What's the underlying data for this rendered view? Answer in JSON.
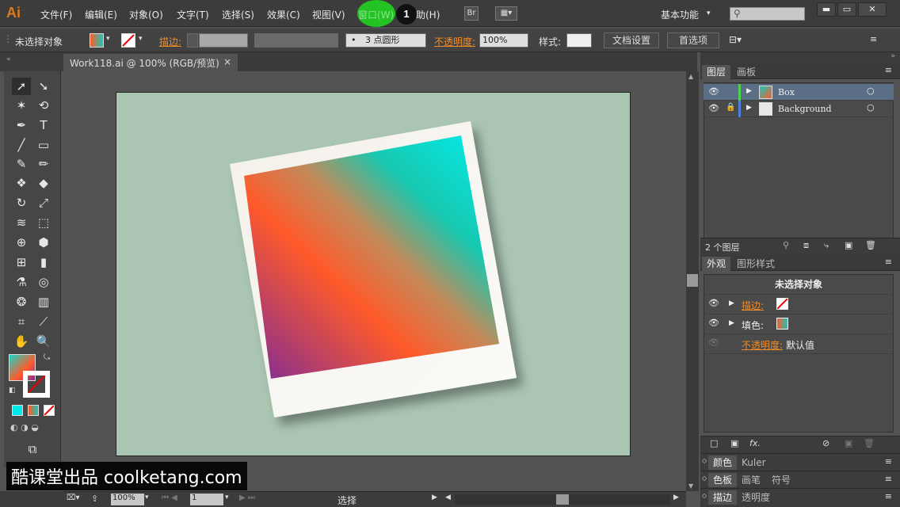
{
  "app": {
    "logo": "Ai"
  },
  "menus": [
    "文件(F)",
    "编辑(E)",
    "对象(O)",
    "文字(T)",
    "选择(S)",
    "效果(C)",
    "视图(V)",
    "窗口(W)",
    "帮助(H)"
  ],
  "menubar": {
    "bridge_btn": "Br",
    "workspace": "基本功能",
    "callout_number": "1"
  },
  "window_controls": {
    "minimize": "▬",
    "restore": "▭",
    "close": "✕"
  },
  "control_bar": {
    "selection_status": "未选择对象",
    "stroke_label": "描边:",
    "brush": "3 点圆形",
    "brush_dot": "•",
    "opacity_label": "不透明度:",
    "opacity_value": "100%",
    "style_label": "样式:",
    "doc_setup": "文档设置",
    "preferences": "首选项"
  },
  "document": {
    "tab_title": "Work118.ai @ 100% (RGB/预览)",
    "close": "×"
  },
  "layers_panel": {
    "tabs": [
      "图层",
      "画板"
    ],
    "layers": [
      {
        "name": "Box",
        "color": "#4fd04f"
      },
      {
        "name": "Background",
        "color": "#4f7fe0"
      }
    ],
    "count": "2 个图层"
  },
  "appearance_panel": {
    "tabs": [
      "外观",
      "图形样式"
    ],
    "header": "未选择对象",
    "stroke_label": "描边:",
    "fill_label": "填色:",
    "opacity_label": "不透明度:",
    "opacity_value": "默认值",
    "fx": "fx."
  },
  "bottom_panels": [
    {
      "tabs": [
        "颜色",
        "Kuler"
      ]
    },
    {
      "tabs": [
        "色板",
        "画笔",
        "符号"
      ]
    },
    {
      "tabs": [
        "描边",
        "透明度"
      ]
    }
  ],
  "status_bar": {
    "zoom": "100%",
    "artboard": "1",
    "tool": "选择"
  },
  "watermark": "酷课堂出品 coolketang.com",
  "colors": {
    "accent": "#f08c28",
    "highlight": "#22c322",
    "artboard": "#aac5b2"
  }
}
